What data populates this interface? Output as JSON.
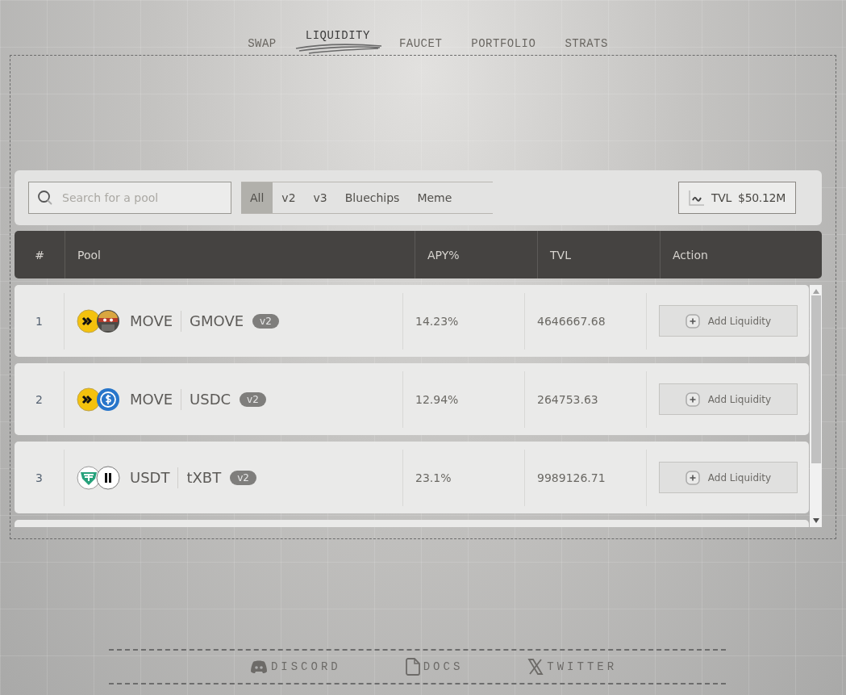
{
  "nav": [
    {
      "label": "SWAP",
      "selected": false
    },
    {
      "label": "LIQUIDITY",
      "selected": true
    },
    {
      "label": "FAUCET",
      "selected": false
    },
    {
      "label": "PORTFOLIO",
      "selected": false
    },
    {
      "label": "STRATS",
      "selected": false
    }
  ],
  "search": {
    "placeholder": "Search for a pool"
  },
  "filters": [
    {
      "label": "All",
      "selected": true
    },
    {
      "label": "v2",
      "selected": false
    },
    {
      "label": "v3",
      "selected": false
    },
    {
      "label": "Bluechips",
      "selected": false
    },
    {
      "label": "Meme",
      "selected": false
    }
  ],
  "tvl": {
    "label": "TVL",
    "value": "$50.12M"
  },
  "table": {
    "columns": [
      "#",
      "Pool",
      "APY%",
      "TVL",
      "Action"
    ],
    "rows": [
      {
        "index": "1",
        "tokens": [
          {
            "symbol": "MOVE",
            "kind": "move"
          },
          {
            "symbol": "GMOVE",
            "kind": "meme"
          }
        ],
        "version": "v2",
        "apy": "14.23%",
        "tvl": "4646667.68",
        "action": "Add Liquidity"
      },
      {
        "index": "2",
        "tokens": [
          {
            "symbol": "MOVE",
            "kind": "move"
          },
          {
            "symbol": "USDC",
            "kind": "usdc"
          }
        ],
        "version": "v2",
        "apy": "12.94%",
        "tvl": "264753.63",
        "action": "Add Liquidity"
      },
      {
        "index": "3",
        "tokens": [
          {
            "symbol": "USDT",
            "kind": "usdt"
          },
          {
            "symbol": "tXBT",
            "kind": "bars"
          }
        ],
        "version": "v2",
        "apy": "23.1%",
        "tvl": "9989126.71",
        "action": "Add Liquidity"
      }
    ]
  },
  "footer": [
    {
      "label": "DISCORD",
      "kind": "discord"
    },
    {
      "label": "DOCS",
      "kind": "docs"
    },
    {
      "label": "TWITTER",
      "kind": "x"
    }
  ]
}
